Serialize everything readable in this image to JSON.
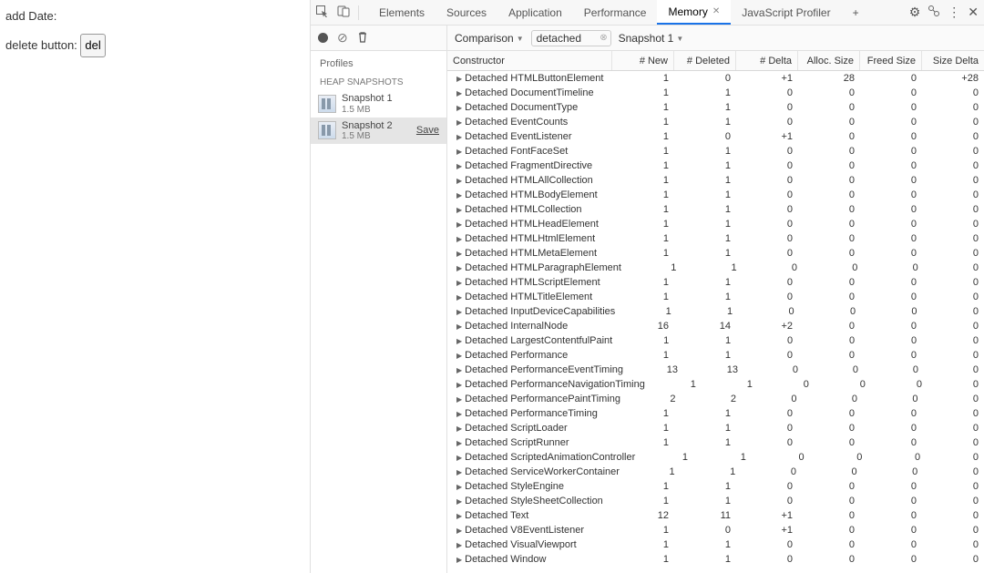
{
  "page": {
    "add_date_label": "add Date:",
    "delete_button_label": "delete button:",
    "del_button": "del"
  },
  "tabs": {
    "elements": "Elements",
    "sources": "Sources",
    "application": "Application",
    "performance": "Performance",
    "memory": "Memory",
    "jsprofiler": "JavaScript Profiler",
    "plus": "+"
  },
  "toolbar": {
    "comparison": "Comparison",
    "filter_value": "detached",
    "snapshot_select": "Snapshot 1"
  },
  "profiles": {
    "header": "Profiles",
    "section": "HEAP SNAPSHOTS",
    "items": [
      {
        "name": "Snapshot 1",
        "size": "1.5 MB"
      },
      {
        "name": "Snapshot 2",
        "size": "1.5 MB",
        "save": "Save"
      }
    ]
  },
  "columns": {
    "constructor": "Constructor",
    "new": "# New",
    "deleted": "# Deleted",
    "delta": "# Delta",
    "alloc": "Alloc. Size",
    "freed": "Freed Size",
    "sdelta": "Size Delta"
  },
  "rows": [
    {
      "c": "Detached HTMLButtonElement",
      "n": 1,
      "d": 0,
      "dl": "+1",
      "a": 28,
      "f": 0,
      "sd": "+28"
    },
    {
      "c": "Detached DocumentTimeline",
      "n": 1,
      "d": 1,
      "dl": "0",
      "a": 0,
      "f": 0,
      "sd": "0"
    },
    {
      "c": "Detached DocumentType",
      "n": 1,
      "d": 1,
      "dl": "0",
      "a": 0,
      "f": 0,
      "sd": "0"
    },
    {
      "c": "Detached EventCounts",
      "n": 1,
      "d": 1,
      "dl": "0",
      "a": 0,
      "f": 0,
      "sd": "0"
    },
    {
      "c": "Detached EventListener",
      "n": 1,
      "d": 0,
      "dl": "+1",
      "a": 0,
      "f": 0,
      "sd": "0"
    },
    {
      "c": "Detached FontFaceSet",
      "n": 1,
      "d": 1,
      "dl": "0",
      "a": 0,
      "f": 0,
      "sd": "0"
    },
    {
      "c": "Detached FragmentDirective",
      "n": 1,
      "d": 1,
      "dl": "0",
      "a": 0,
      "f": 0,
      "sd": "0"
    },
    {
      "c": "Detached HTMLAllCollection",
      "n": 1,
      "d": 1,
      "dl": "0",
      "a": 0,
      "f": 0,
      "sd": "0"
    },
    {
      "c": "Detached HTMLBodyElement",
      "n": 1,
      "d": 1,
      "dl": "0",
      "a": 0,
      "f": 0,
      "sd": "0"
    },
    {
      "c": "Detached HTMLCollection",
      "n": 1,
      "d": 1,
      "dl": "0",
      "a": 0,
      "f": 0,
      "sd": "0"
    },
    {
      "c": "Detached HTMLHeadElement",
      "n": 1,
      "d": 1,
      "dl": "0",
      "a": 0,
      "f": 0,
      "sd": "0"
    },
    {
      "c": "Detached HTMLHtmlElement",
      "n": 1,
      "d": 1,
      "dl": "0",
      "a": 0,
      "f": 0,
      "sd": "0"
    },
    {
      "c": "Detached HTMLMetaElement",
      "n": 1,
      "d": 1,
      "dl": "0",
      "a": 0,
      "f": 0,
      "sd": "0"
    },
    {
      "c": "Detached HTMLParagraphElement",
      "n": 1,
      "d": 1,
      "dl": "0",
      "a": 0,
      "f": 0,
      "sd": "0"
    },
    {
      "c": "Detached HTMLScriptElement",
      "n": 1,
      "d": 1,
      "dl": "0",
      "a": 0,
      "f": 0,
      "sd": "0"
    },
    {
      "c": "Detached HTMLTitleElement",
      "n": 1,
      "d": 1,
      "dl": "0",
      "a": 0,
      "f": 0,
      "sd": "0"
    },
    {
      "c": "Detached InputDeviceCapabilities",
      "n": 1,
      "d": 1,
      "dl": "0",
      "a": 0,
      "f": 0,
      "sd": "0"
    },
    {
      "c": "Detached InternalNode",
      "n": 16,
      "d": 14,
      "dl": "+2",
      "a": 0,
      "f": 0,
      "sd": "0"
    },
    {
      "c": "Detached LargestContentfulPaint",
      "n": 1,
      "d": 1,
      "dl": "0",
      "a": 0,
      "f": 0,
      "sd": "0"
    },
    {
      "c": "Detached Performance",
      "n": 1,
      "d": 1,
      "dl": "0",
      "a": 0,
      "f": 0,
      "sd": "0"
    },
    {
      "c": "Detached PerformanceEventTiming",
      "n": 13,
      "d": 13,
      "dl": "0",
      "a": 0,
      "f": 0,
      "sd": "0"
    },
    {
      "c": "Detached PerformanceNavigationTiming",
      "n": 1,
      "d": 1,
      "dl": "0",
      "a": 0,
      "f": 0,
      "sd": "0"
    },
    {
      "c": "Detached PerformancePaintTiming",
      "n": 2,
      "d": 2,
      "dl": "0",
      "a": 0,
      "f": 0,
      "sd": "0"
    },
    {
      "c": "Detached PerformanceTiming",
      "n": 1,
      "d": 1,
      "dl": "0",
      "a": 0,
      "f": 0,
      "sd": "0"
    },
    {
      "c": "Detached ScriptLoader",
      "n": 1,
      "d": 1,
      "dl": "0",
      "a": 0,
      "f": 0,
      "sd": "0"
    },
    {
      "c": "Detached ScriptRunner",
      "n": 1,
      "d": 1,
      "dl": "0",
      "a": 0,
      "f": 0,
      "sd": "0"
    },
    {
      "c": "Detached ScriptedAnimationController",
      "n": 1,
      "d": 1,
      "dl": "0",
      "a": 0,
      "f": 0,
      "sd": "0"
    },
    {
      "c": "Detached ServiceWorkerContainer",
      "n": 1,
      "d": 1,
      "dl": "0",
      "a": 0,
      "f": 0,
      "sd": "0"
    },
    {
      "c": "Detached StyleEngine",
      "n": 1,
      "d": 1,
      "dl": "0",
      "a": 0,
      "f": 0,
      "sd": "0"
    },
    {
      "c": "Detached StyleSheetCollection",
      "n": 1,
      "d": 1,
      "dl": "0",
      "a": 0,
      "f": 0,
      "sd": "0"
    },
    {
      "c": "Detached Text",
      "n": 12,
      "d": 11,
      "dl": "+1",
      "a": 0,
      "f": 0,
      "sd": "0"
    },
    {
      "c": "Detached V8EventListener",
      "n": 1,
      "d": 0,
      "dl": "+1",
      "a": 0,
      "f": 0,
      "sd": "0"
    },
    {
      "c": "Detached VisualViewport",
      "n": 1,
      "d": 1,
      "dl": "0",
      "a": 0,
      "f": 0,
      "sd": "0"
    },
    {
      "c": "Detached Window",
      "n": 1,
      "d": 1,
      "dl": "0",
      "a": 0,
      "f": 0,
      "sd": "0"
    }
  ]
}
